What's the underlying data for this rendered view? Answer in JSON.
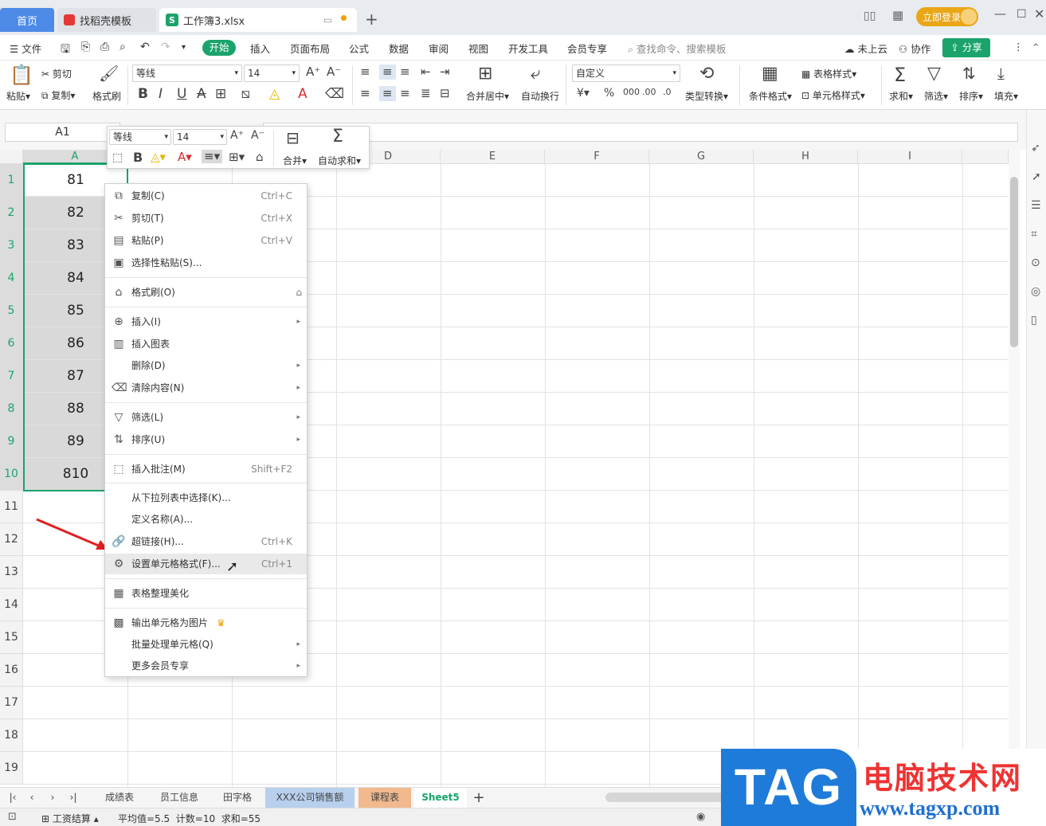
{
  "titlebar": {
    "tabs": [
      {
        "label": "首页"
      },
      {
        "label": "找稻壳模板"
      },
      {
        "label": "工作簿3.xlsx"
      }
    ],
    "login_label": "立即登录"
  },
  "menubar": {
    "file_label": "文件",
    "items": [
      "开始",
      "插入",
      "页面布局",
      "公式",
      "数据",
      "审阅",
      "视图",
      "开发工具",
      "会员专享"
    ],
    "search_placeholder": "查找命令、搜索模板",
    "cloud_label": "未上云",
    "collab_label": "协作",
    "share_label": "分享"
  },
  "ribbon": {
    "paste": "粘贴",
    "cut": "剪切",
    "copy": "复制",
    "format_painter": "格式刷",
    "font_name": "等线",
    "font_size": "14",
    "merge_center": "合并居中",
    "wrap_text": "自动换行",
    "number_format": "自定义",
    "type_convert": "类型转换",
    "conditional_format": "条件格式",
    "table_style": "表格样式",
    "cell_style": "单元格样式",
    "sum": "求和",
    "filter": "筛选",
    "sort": "排序",
    "fill": "填充"
  },
  "formula_bar": {
    "name_box": "A1"
  },
  "mini_toolbar": {
    "font_name": "等线",
    "font_size": "14",
    "merge": "合并",
    "autosum": "自动求和"
  },
  "grid": {
    "columns": [
      "A",
      "B",
      "C",
      "D",
      "E",
      "F",
      "G",
      "H",
      "I"
    ],
    "rows": [
      "1",
      "2",
      "3",
      "4",
      "5",
      "6",
      "7",
      "8",
      "9",
      "10",
      "11",
      "12",
      "13",
      "14",
      "15",
      "16",
      "17",
      "18",
      "19"
    ],
    "col_a_values": [
      "81",
      "82",
      "83",
      "84",
      "85",
      "86",
      "87",
      "88",
      "89",
      "810"
    ]
  },
  "context_menu": {
    "items": [
      {
        "label": "复制(C)",
        "shortcut": "Ctrl+C"
      },
      {
        "label": "剪切(T)",
        "shortcut": "Ctrl+X"
      },
      {
        "label": "粘贴(P)",
        "shortcut": "Ctrl+V"
      },
      {
        "label": "选择性粘贴(S)..."
      },
      {
        "label": "格式刷(O)"
      },
      {
        "label": "插入(I)"
      },
      {
        "label": "插入图表"
      },
      {
        "label": "删除(D)"
      },
      {
        "label": "清除内容(N)"
      },
      {
        "label": "筛选(L)"
      },
      {
        "label": "排序(U)"
      },
      {
        "label": "插入批注(M)",
        "shortcut": "Shift+F2"
      },
      {
        "label": "从下拉列表中选择(K)..."
      },
      {
        "label": "定义名称(A)..."
      },
      {
        "label": "超链接(H)...",
        "shortcut": "Ctrl+K"
      },
      {
        "label": "设置单元格格式(F)...",
        "shortcut": "Ctrl+1"
      },
      {
        "label": "表格整理美化"
      },
      {
        "label": "输出单元格为图片"
      },
      {
        "label": "批量处理单元格(Q)"
      },
      {
        "label": "更多会员专享"
      }
    ]
  },
  "sheets": [
    "成绩表",
    "员工信息",
    "田字格",
    "XXX公司销售额",
    "课程表",
    "Sheet5"
  ],
  "statusbar": {
    "macro_label": "工资结算",
    "stats": "平均值=5.5  计数=10  求和=55"
  },
  "watermark": {
    "tag": "TAG",
    "cn": "电脑技术网",
    "url": "www.tagxp.com"
  },
  "colors": {
    "accent": "#1aa46b",
    "selection": "#d9d9d9",
    "arrow": "#e02020"
  }
}
